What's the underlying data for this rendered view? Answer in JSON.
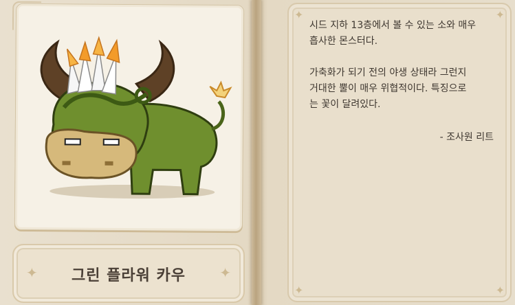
{
  "monster": {
    "name": "그린 플라워 카우",
    "image_icon": "green-flower-cow-sprite"
  },
  "description": {
    "paragraph1": [
      "시드 지하 13층에서 볼 수 있는 소와 매우",
      "흡사한 몬스터다."
    ],
    "paragraph2": [
      "가축화가 되기 전의 야생 상태라 그런지",
      "거대한 뿔이 매우 위협적이다. 특징으로",
      "는 꽃이 달려있다."
    ],
    "signature": "- 조사원 리트"
  },
  "colors": {
    "page": "#e6dcc8",
    "text": "#3e3730",
    "accent": "#cdb992"
  }
}
